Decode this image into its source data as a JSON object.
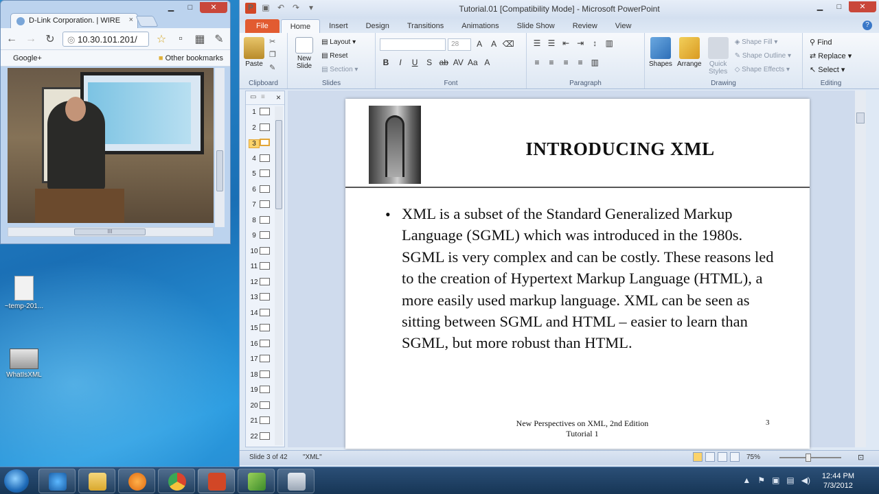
{
  "desktop": {
    "icons": [
      {
        "label": "~temp-201..."
      },
      {
        "label": "WhatIsXML"
      }
    ]
  },
  "browser": {
    "tab_title": "D-Link Corporation. | WIRE",
    "tab_close": "×",
    "url": "10.30.101.201/",
    "bookmark_left": "Google+",
    "bookmark_right": "Other bookmarks",
    "scroll_grip": "III"
  },
  "powerpoint": {
    "window_title": "Tutorial.01 [Compatibility Mode] - Microsoft PowerPoint",
    "app_badge": "P",
    "tabs": [
      "File",
      "Home",
      "Insert",
      "Design",
      "Transitions",
      "Animations",
      "Slide Show",
      "Review",
      "View"
    ],
    "ribbon": {
      "clipboard": {
        "label": "Clipboard",
        "paste": "Paste"
      },
      "slides": {
        "label": "Slides",
        "new_slide": "New Slide",
        "layout": "Layout",
        "reset": "Reset",
        "section": "Section"
      },
      "font": {
        "label": "Font",
        "size": "28"
      },
      "paragraph": {
        "label": "Paragraph"
      },
      "drawing": {
        "label": "Drawing",
        "shapes": "Shapes",
        "arrange": "Arrange",
        "quick_styles": "Quick Styles",
        "shape_fill": "Shape Fill",
        "shape_outline": "Shape Outline",
        "shape_effects": "Shape Effects"
      },
      "editing": {
        "label": "Editing",
        "find": "Find",
        "replace": "Replace",
        "select": "Select"
      }
    },
    "thumbnails": [
      "1",
      "2",
      "3",
      "4",
      "5",
      "6",
      "7",
      "8",
      "9",
      "10",
      "11",
      "12",
      "13",
      "14",
      "15",
      "16",
      "17",
      "18",
      "19",
      "20",
      "21",
      "22"
    ],
    "selected_slide": 3,
    "slide": {
      "title": "INTRODUCING XML",
      "bullet": "•",
      "body": "XML is a subset of the Standard Generalized Markup Language (SGML) which was introduced in the 1980s. SGML is very complex and can be costly. These reasons led to the creation of Hypertext Markup Language (HTML), a more easily used markup language. XML can be seen as sitting between SGML and HTML – easier to learn than SGML, but more robust than HTML.",
      "footer_line1": "New Perspectives on XML, 2nd Edition",
      "footer_line2": "Tutorial 1",
      "page_number": "3"
    },
    "status": {
      "slide_count": "Slide 3 of 42",
      "theme": "\"XML\"",
      "zoom": "75%"
    }
  },
  "taskbar": {
    "time": "12:44 PM",
    "date": "7/3/2012"
  },
  "colors": {
    "file_tab": "#e25b31",
    "selection": "#fbd36b",
    "desktop": "#1a6fb5"
  }
}
